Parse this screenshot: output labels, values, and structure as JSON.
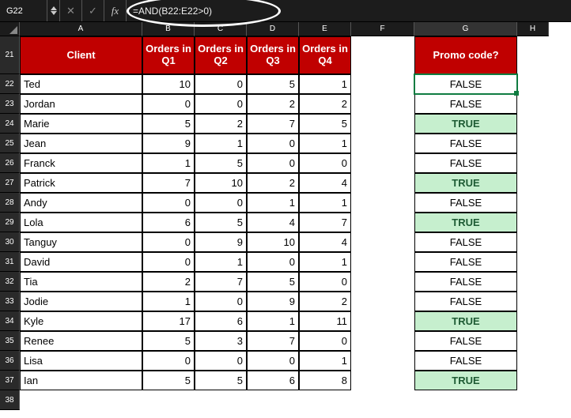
{
  "formula_bar": {
    "name_box": "G22",
    "cancel_icon": "✕",
    "confirm_icon": "✓",
    "fx_label": "fx",
    "formula": "=AND(B22:E22>0)"
  },
  "columns": [
    "A",
    "B",
    "C",
    "D",
    "E",
    "F",
    "G",
    "H"
  ],
  "row_numbers": [
    21,
    22,
    23,
    24,
    25,
    26,
    27,
    28,
    29,
    30,
    31,
    32,
    33,
    34,
    35,
    36,
    37,
    38
  ],
  "table": {
    "headers": {
      "client": "Client",
      "q1": "Orders in Q1",
      "q2": "Orders in Q2",
      "q3": "Orders in Q3",
      "q4": "Orders in Q4",
      "promo": "Promo code?"
    },
    "rows": [
      {
        "client": "Ted",
        "q1": 10,
        "q2": 0,
        "q3": 5,
        "q4": 1,
        "promo": "FALSE"
      },
      {
        "client": "Jordan",
        "q1": 0,
        "q2": 0,
        "q3": 2,
        "q4": 2,
        "promo": "FALSE"
      },
      {
        "client": "Marie",
        "q1": 5,
        "q2": 2,
        "q3": 7,
        "q4": 5,
        "promo": "TRUE"
      },
      {
        "client": "Jean",
        "q1": 9,
        "q2": 1,
        "q3": 0,
        "q4": 1,
        "promo": "FALSE"
      },
      {
        "client": "Franck",
        "q1": 1,
        "q2": 5,
        "q3": 0,
        "q4": 0,
        "promo": "FALSE"
      },
      {
        "client": "Patrick",
        "q1": 7,
        "q2": 10,
        "q3": 2,
        "q4": 4,
        "promo": "TRUE"
      },
      {
        "client": "Andy",
        "q1": 0,
        "q2": 0,
        "q3": 1,
        "q4": 1,
        "promo": "FALSE"
      },
      {
        "client": "Lola",
        "q1": 6,
        "q2": 5,
        "q3": 4,
        "q4": 7,
        "promo": "TRUE"
      },
      {
        "client": "Tanguy",
        "q1": 0,
        "q2": 9,
        "q3": 10,
        "q4": 4,
        "promo": "FALSE"
      },
      {
        "client": "David",
        "q1": 0,
        "q2": 1,
        "q3": 0,
        "q4": 1,
        "promo": "FALSE"
      },
      {
        "client": "Tia",
        "q1": 2,
        "q2": 7,
        "q3": 5,
        "q4": 0,
        "promo": "FALSE"
      },
      {
        "client": "Jodie",
        "q1": 1,
        "q2": 0,
        "q3": 9,
        "q4": 2,
        "promo": "FALSE"
      },
      {
        "client": "Kyle",
        "q1": 17,
        "q2": 6,
        "q3": 1,
        "q4": 11,
        "promo": "TRUE"
      },
      {
        "client": "Renee",
        "q1": 5,
        "q2": 3,
        "q3": 7,
        "q4": 0,
        "promo": "FALSE"
      },
      {
        "client": "Lisa",
        "q1": 0,
        "q2": 0,
        "q3": 0,
        "q4": 1,
        "promo": "FALSE"
      },
      {
        "client": "Ian",
        "q1": 5,
        "q2": 5,
        "q3": 6,
        "q4": 8,
        "promo": "TRUE"
      }
    ]
  },
  "colors": {
    "header_bg": "#c00000",
    "true_bg": "#c6efce",
    "selection": "#107c41"
  },
  "selected_cell": "G22"
}
